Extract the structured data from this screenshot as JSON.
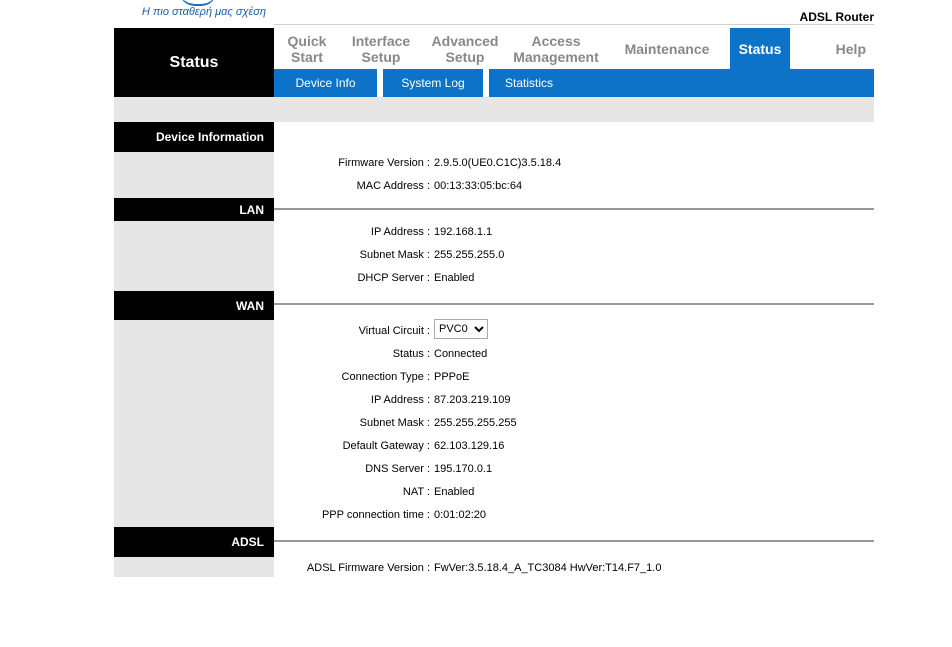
{
  "header": {
    "tagline": "Η πιο σταθερή μας σχέση",
    "product": "ADSL Router",
    "page_title": "Status"
  },
  "nav": {
    "items": [
      {
        "label": "Quick\nStart"
      },
      {
        "label": "Interface\nSetup"
      },
      {
        "label": "Advanced\nSetup"
      },
      {
        "label": "Access\nManagement"
      },
      {
        "label": "Maintenance"
      },
      {
        "label": "Status"
      },
      {
        "label": "Help"
      }
    ],
    "active": "Status"
  },
  "subnav": {
    "items": [
      {
        "label": "Device Info"
      },
      {
        "label": "System Log"
      },
      {
        "label": "Statistics"
      }
    ]
  },
  "sections": {
    "device": {
      "title": "Device Information",
      "firmware_label": "Firmware Version :",
      "firmware_value": "2.9.5.0(UE0.C1C)3.5.18.4",
      "mac_label": "MAC Address :",
      "mac_value": "00:13:33:05:bc:64"
    },
    "lan": {
      "title": "LAN",
      "ip_label": "IP Address :",
      "ip_value": "192.168.1.1",
      "mask_label": "Subnet Mask :",
      "mask_value": "255.255.255.0",
      "dhcp_label": "DHCP Server :",
      "dhcp_value": "Enabled"
    },
    "wan": {
      "title": "WAN",
      "vc_label": "Virtual Circuit :",
      "vc_value": "PVC0",
      "status_label": "Status :",
      "status_value": "Connected",
      "conn_label": "Connection Type :",
      "conn_value": "PPPoE",
      "ip_label": "IP Address :",
      "ip_value": "87.203.219.109",
      "mask_label": "Subnet Mask :",
      "mask_value": "255.255.255.255",
      "gw_label": "Default Gateway :",
      "gw_value": "62.103.129.16",
      "dns_label": "DNS Server :",
      "dns_value": "195.170.0.1",
      "nat_label": "NAT :",
      "nat_value": "Enabled",
      "ppp_label": "PPP connection time :",
      "ppp_value": "0:01:02:20"
    },
    "adsl": {
      "title": "ADSL",
      "fw_label": "ADSL Firmware Version :",
      "fw_value": "FwVer:3.5.18.4_A_TC3084 HwVer:T14.F7_1.0"
    }
  },
  "colors": {
    "accent": "#0d73c8",
    "header_black": "#000000",
    "side_grey": "#e6e6e6"
  }
}
